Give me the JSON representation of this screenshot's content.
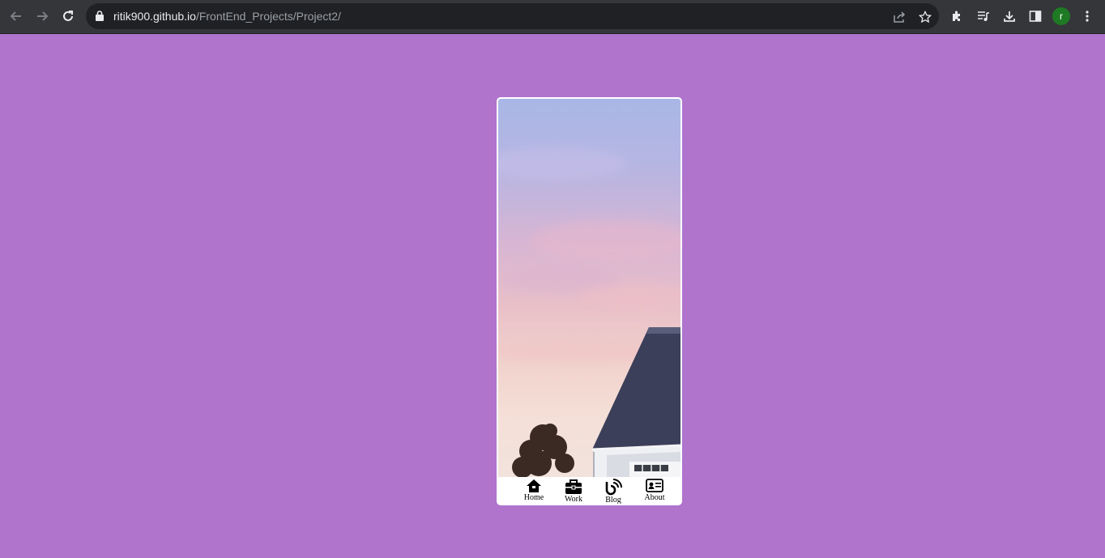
{
  "browser": {
    "url_host": "ritik900.github.io",
    "url_path": "/FrontEnd_Projects/Project2/",
    "profile_initial": "r",
    "icons": [
      "back-icon",
      "forward-icon",
      "reload-icon",
      "lock-icon",
      "share-icon",
      "star-icon",
      "extensions-icon",
      "media-icon",
      "download-icon",
      "side-panel-icon",
      "menu-icon"
    ]
  },
  "app": {
    "background_color": "#b074cd",
    "nav": [
      {
        "label": "Home",
        "icon": "home-icon"
      },
      {
        "label": "Work",
        "icon": "briefcase-icon"
      },
      {
        "label": "Blog",
        "icon": "blog-icon"
      },
      {
        "label": "About",
        "icon": "id-card-icon"
      }
    ]
  }
}
